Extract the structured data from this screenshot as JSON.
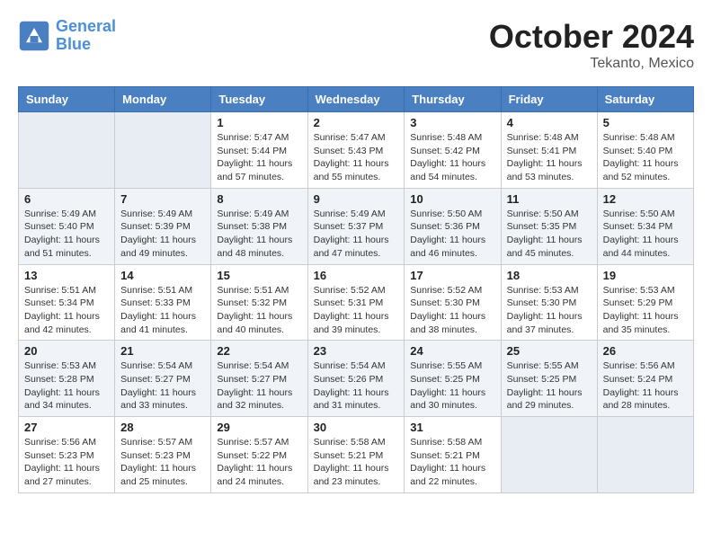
{
  "header": {
    "logo_line1": "General",
    "logo_line2": "Blue",
    "month": "October 2024",
    "location": "Tekanto, Mexico"
  },
  "weekdays": [
    "Sunday",
    "Monday",
    "Tuesday",
    "Wednesday",
    "Thursday",
    "Friday",
    "Saturday"
  ],
  "weeks": [
    [
      {
        "day": "",
        "info": ""
      },
      {
        "day": "",
        "info": ""
      },
      {
        "day": "1",
        "info": "Sunrise: 5:47 AM\nSunset: 5:44 PM\nDaylight: 11 hours and 57 minutes."
      },
      {
        "day": "2",
        "info": "Sunrise: 5:47 AM\nSunset: 5:43 PM\nDaylight: 11 hours and 55 minutes."
      },
      {
        "day": "3",
        "info": "Sunrise: 5:48 AM\nSunset: 5:42 PM\nDaylight: 11 hours and 54 minutes."
      },
      {
        "day": "4",
        "info": "Sunrise: 5:48 AM\nSunset: 5:41 PM\nDaylight: 11 hours and 53 minutes."
      },
      {
        "day": "5",
        "info": "Sunrise: 5:48 AM\nSunset: 5:40 PM\nDaylight: 11 hours and 52 minutes."
      }
    ],
    [
      {
        "day": "6",
        "info": "Sunrise: 5:49 AM\nSunset: 5:40 PM\nDaylight: 11 hours and 51 minutes."
      },
      {
        "day": "7",
        "info": "Sunrise: 5:49 AM\nSunset: 5:39 PM\nDaylight: 11 hours and 49 minutes."
      },
      {
        "day": "8",
        "info": "Sunrise: 5:49 AM\nSunset: 5:38 PM\nDaylight: 11 hours and 48 minutes."
      },
      {
        "day": "9",
        "info": "Sunrise: 5:49 AM\nSunset: 5:37 PM\nDaylight: 11 hours and 47 minutes."
      },
      {
        "day": "10",
        "info": "Sunrise: 5:50 AM\nSunset: 5:36 PM\nDaylight: 11 hours and 46 minutes."
      },
      {
        "day": "11",
        "info": "Sunrise: 5:50 AM\nSunset: 5:35 PM\nDaylight: 11 hours and 45 minutes."
      },
      {
        "day": "12",
        "info": "Sunrise: 5:50 AM\nSunset: 5:34 PM\nDaylight: 11 hours and 44 minutes."
      }
    ],
    [
      {
        "day": "13",
        "info": "Sunrise: 5:51 AM\nSunset: 5:34 PM\nDaylight: 11 hours and 42 minutes."
      },
      {
        "day": "14",
        "info": "Sunrise: 5:51 AM\nSunset: 5:33 PM\nDaylight: 11 hours and 41 minutes."
      },
      {
        "day": "15",
        "info": "Sunrise: 5:51 AM\nSunset: 5:32 PM\nDaylight: 11 hours and 40 minutes."
      },
      {
        "day": "16",
        "info": "Sunrise: 5:52 AM\nSunset: 5:31 PM\nDaylight: 11 hours and 39 minutes."
      },
      {
        "day": "17",
        "info": "Sunrise: 5:52 AM\nSunset: 5:30 PM\nDaylight: 11 hours and 38 minutes."
      },
      {
        "day": "18",
        "info": "Sunrise: 5:53 AM\nSunset: 5:30 PM\nDaylight: 11 hours and 37 minutes."
      },
      {
        "day": "19",
        "info": "Sunrise: 5:53 AM\nSunset: 5:29 PM\nDaylight: 11 hours and 35 minutes."
      }
    ],
    [
      {
        "day": "20",
        "info": "Sunrise: 5:53 AM\nSunset: 5:28 PM\nDaylight: 11 hours and 34 minutes."
      },
      {
        "day": "21",
        "info": "Sunrise: 5:54 AM\nSunset: 5:27 PM\nDaylight: 11 hours and 33 minutes."
      },
      {
        "day": "22",
        "info": "Sunrise: 5:54 AM\nSunset: 5:27 PM\nDaylight: 11 hours and 32 minutes."
      },
      {
        "day": "23",
        "info": "Sunrise: 5:54 AM\nSunset: 5:26 PM\nDaylight: 11 hours and 31 minutes."
      },
      {
        "day": "24",
        "info": "Sunrise: 5:55 AM\nSunset: 5:25 PM\nDaylight: 11 hours and 30 minutes."
      },
      {
        "day": "25",
        "info": "Sunrise: 5:55 AM\nSunset: 5:25 PM\nDaylight: 11 hours and 29 minutes."
      },
      {
        "day": "26",
        "info": "Sunrise: 5:56 AM\nSunset: 5:24 PM\nDaylight: 11 hours and 28 minutes."
      }
    ],
    [
      {
        "day": "27",
        "info": "Sunrise: 5:56 AM\nSunset: 5:23 PM\nDaylight: 11 hours and 27 minutes."
      },
      {
        "day": "28",
        "info": "Sunrise: 5:57 AM\nSunset: 5:23 PM\nDaylight: 11 hours and 25 minutes."
      },
      {
        "day": "29",
        "info": "Sunrise: 5:57 AM\nSunset: 5:22 PM\nDaylight: 11 hours and 24 minutes."
      },
      {
        "day": "30",
        "info": "Sunrise: 5:58 AM\nSunset: 5:21 PM\nDaylight: 11 hours and 23 minutes."
      },
      {
        "day": "31",
        "info": "Sunrise: 5:58 AM\nSunset: 5:21 PM\nDaylight: 11 hours and 22 minutes."
      },
      {
        "day": "",
        "info": ""
      },
      {
        "day": "",
        "info": ""
      }
    ]
  ]
}
